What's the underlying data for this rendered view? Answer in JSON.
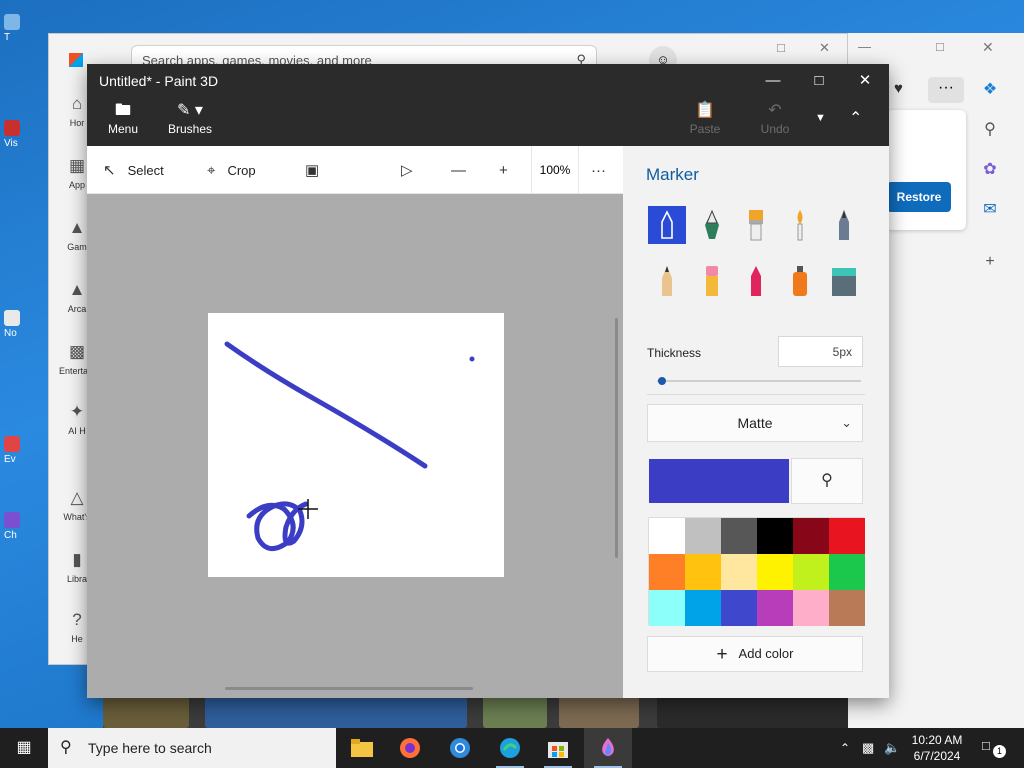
{
  "desktop": {
    "icons": [
      "T",
      "Vis",
      "No",
      "Ev",
      "Ch"
    ]
  },
  "store": {
    "search_placeholder": "Search apps, games, movies, and more",
    "side": [
      "Hor",
      "App",
      "Gam",
      "Arca",
      "Entertain",
      "AI H",
      "What's",
      "Libra",
      "He"
    ],
    "restore_label": "Restore"
  },
  "paint": {
    "title": "Untitled* - Paint 3D",
    "ribbon": {
      "menu": "Menu",
      "brushes": "Brushes",
      "paste": "Paste",
      "undo": "Undo"
    },
    "toolbar": {
      "select": "Select",
      "crop": "Crop",
      "zoom": "100%"
    },
    "panel": {
      "title": "Marker",
      "thickness_label": "Thickness",
      "thickness_value": "5px",
      "thickness_level": 0.02,
      "finish": "Matte",
      "add_color": "Add color",
      "current_color": "#3b3ec4",
      "brushes": [
        "marker",
        "calligraphy-pen",
        "oil-brush",
        "watercolor",
        "pixel-pen",
        "pencil",
        "eraser",
        "crayon",
        "spray-can",
        "fill-bucket"
      ],
      "swatches": [
        "#ffffff",
        "#c0c0c0",
        "#575757",
        "#000000",
        "#870718",
        "#e8141f",
        "#ff7f27",
        "#ffc20e",
        "#ffe7a0",
        "#fff200",
        "#c1f11c",
        "#1bc84b",
        "#8cfffb",
        "#00a2e8",
        "#3f48cc",
        "#b83dba",
        "#ffaec9",
        "#b97a57"
      ]
    }
  },
  "taskbar": {
    "search_placeholder": "Type here to search",
    "time": "10:20 AM",
    "date": "6/7/2024",
    "notification_count": "1"
  }
}
